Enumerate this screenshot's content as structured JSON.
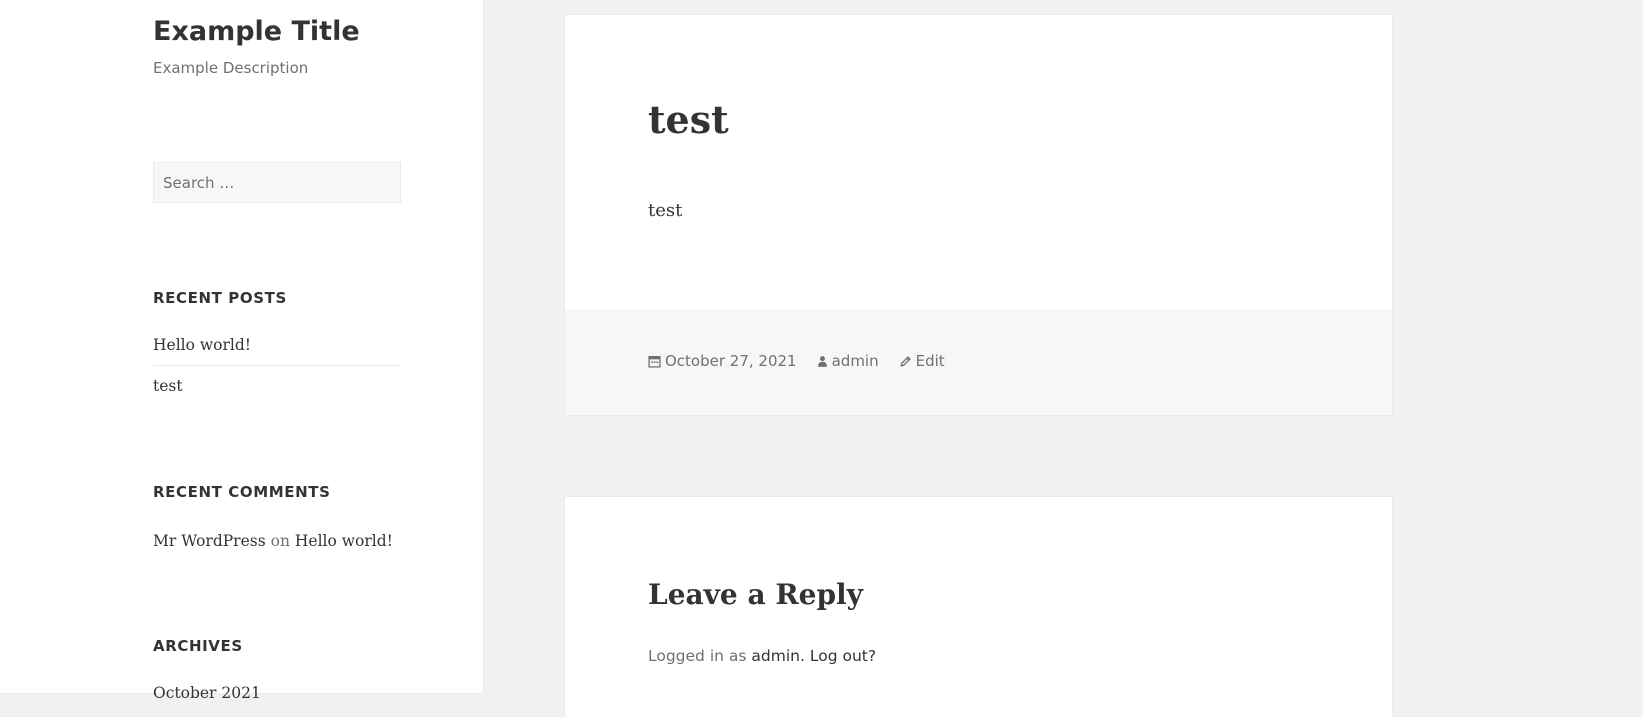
{
  "site": {
    "title": "Example Title",
    "description": "Example Description"
  },
  "search": {
    "placeholder": "Search …"
  },
  "recent_posts": {
    "heading": "Recent Posts",
    "items": [
      "Hello world!",
      "test"
    ]
  },
  "recent_comments": {
    "heading": "Recent Comments",
    "author": "Mr WordPress",
    "connector": "on",
    "post": "Hello world!"
  },
  "archives": {
    "heading": "Archives",
    "items": [
      "October 2021"
    ]
  },
  "post": {
    "title": "test",
    "body": "test",
    "date": "October 27, 2021",
    "author": "admin",
    "edit_label": "Edit",
    "icons": [
      "calendar-icon",
      "person-icon",
      "pencil-icon"
    ]
  },
  "reply": {
    "heading": "Leave a Reply",
    "logged_in_prefix": "Logged in as",
    "user": "admin",
    "separator": ".",
    "logout": "Log out?"
  },
  "colors": {
    "page_background": "#f1f1f1",
    "text": "#333333",
    "muted_text": "#707070",
    "footer_background": "#f7f7f7"
  }
}
